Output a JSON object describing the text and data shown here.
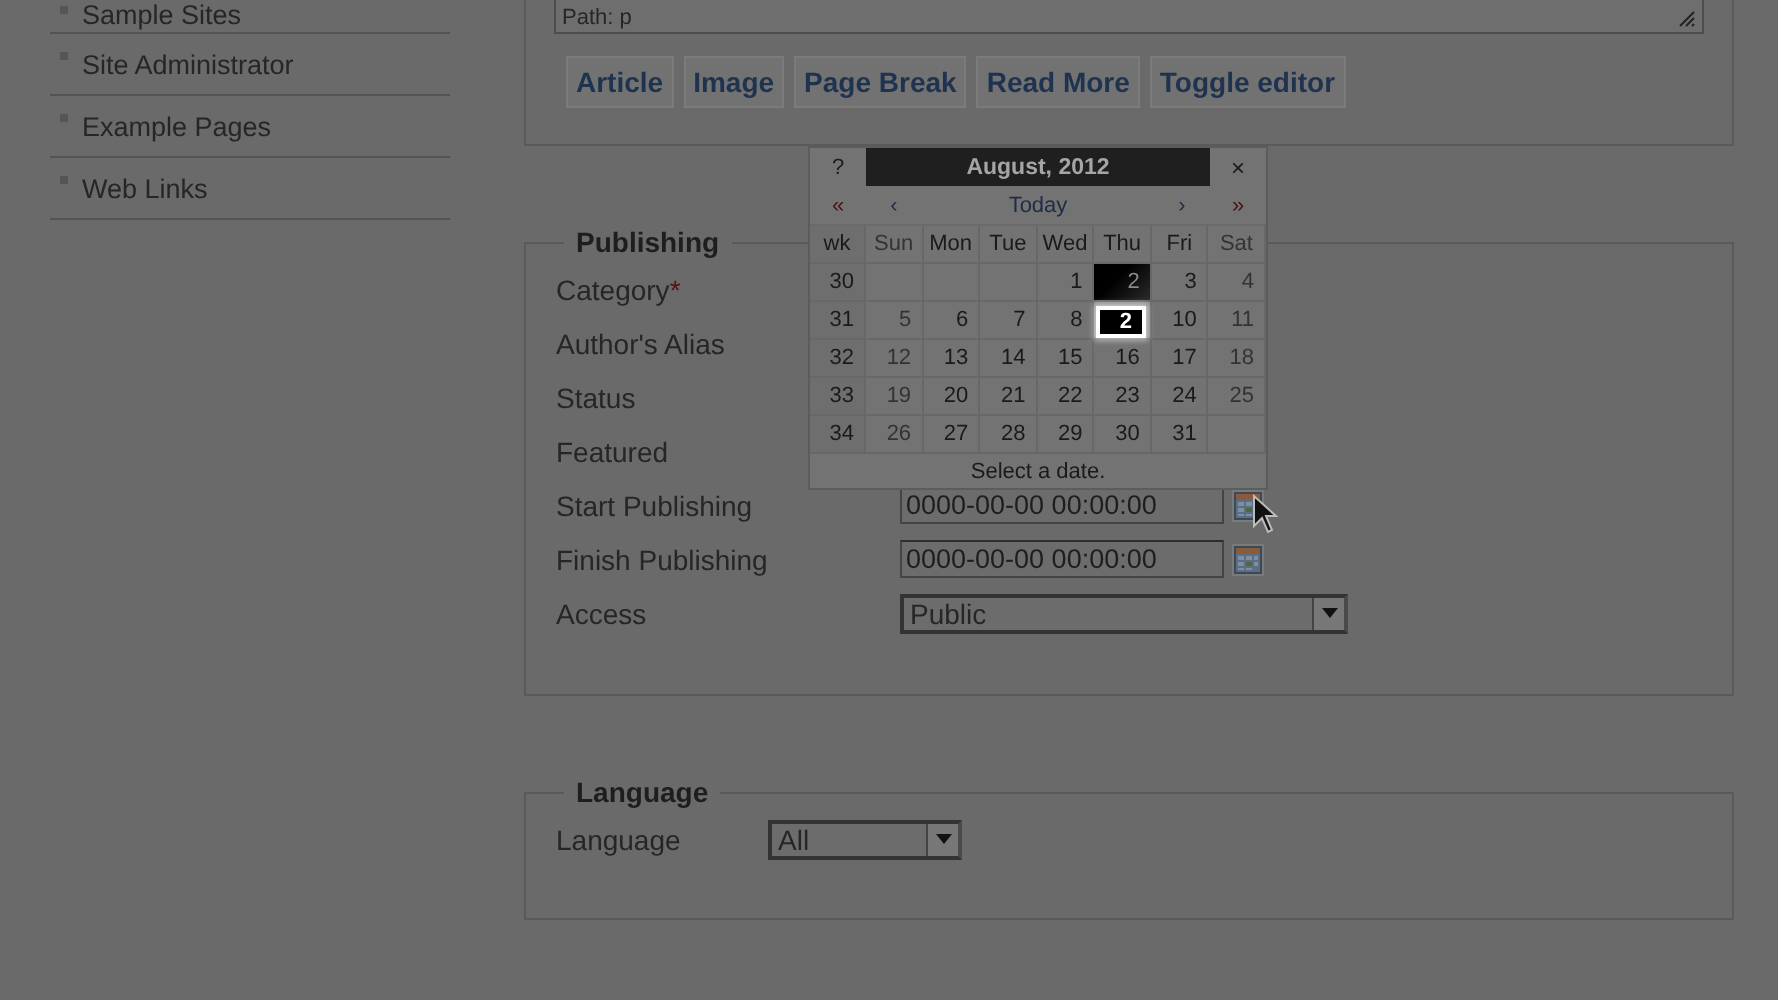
{
  "sidebar": {
    "items": [
      {
        "label": "Sample Sites"
      },
      {
        "label": "Site Administrator"
      },
      {
        "label": "Example Pages"
      },
      {
        "label": "Web Links"
      }
    ]
  },
  "editor": {
    "path": "Path: p",
    "buttons": [
      "Article",
      "Image",
      "Page Break",
      "Read More",
      "Toggle editor"
    ]
  },
  "publishing": {
    "legend": "Publishing",
    "fields": [
      {
        "label": "Category",
        "required_mark": "*",
        "kind": "label"
      },
      {
        "label": "Author's Alias",
        "kind": "label"
      },
      {
        "label": "Status",
        "kind": "label"
      },
      {
        "label": "Featured",
        "kind": "label"
      },
      {
        "label": "Start Publishing",
        "kind": "date",
        "value": "0000-00-00 00:00:00"
      },
      {
        "label": "Finish Publishing",
        "kind": "date",
        "value": "0000-00-00 00:00:00"
      },
      {
        "label": "Access",
        "kind": "select",
        "value": "Public"
      }
    ]
  },
  "calendar": {
    "help": "?",
    "title": "August, 2012",
    "close": "×",
    "nav": [
      "«",
      "‹",
      "Today",
      "›",
      "»"
    ],
    "week_header": "wk",
    "weekdays": [
      {
        "label": "Sun",
        "weekend": true
      },
      {
        "label": "Mon",
        "weekend": false
      },
      {
        "label": "Tue",
        "weekend": false
      },
      {
        "label": "Wed",
        "weekend": false
      },
      {
        "label": "Thu",
        "weekend": false
      },
      {
        "label": "Fri",
        "weekend": false
      },
      {
        "label": "Sat",
        "weekend": true
      }
    ],
    "weeks": [
      {
        "wk": "30",
        "days": [
          {
            "kind": "blank"
          },
          {
            "kind": "blank"
          },
          {
            "kind": "blank"
          },
          {
            "d": "1",
            "selected": false
          },
          {
            "d": "2",
            "selected": true
          },
          {
            "d": "3",
            "selected": false
          },
          {
            "d": "4",
            "selected": false
          }
        ]
      },
      {
        "wk": "31",
        "days": [
          {
            "d": "5",
            "selected": false
          },
          {
            "d": "6",
            "selected": false
          },
          {
            "d": "7",
            "selected": false
          },
          {
            "d": "8",
            "selected": false
          },
          {
            "kind": "covered"
          },
          {
            "d": "10",
            "selected": false
          },
          {
            "d": "11",
            "selected": false
          }
        ]
      },
      {
        "wk": "32",
        "days": [
          {
            "d": "12",
            "selected": false
          },
          {
            "d": "13",
            "selected": false
          },
          {
            "d": "14",
            "selected": false
          },
          {
            "d": "15",
            "selected": false
          },
          {
            "d": "16",
            "selected": false
          },
          {
            "d": "17",
            "selected": false
          },
          {
            "d": "18",
            "selected": false
          }
        ]
      },
      {
        "wk": "33",
        "days": [
          {
            "d": "19",
            "selected": false
          },
          {
            "d": "20",
            "selected": false
          },
          {
            "d": "21",
            "selected": false
          },
          {
            "d": "22",
            "selected": false
          },
          {
            "d": "23",
            "selected": false
          },
          {
            "d": "24",
            "selected": false
          },
          {
            "d": "25",
            "selected": false
          }
        ]
      },
      {
        "wk": "34",
        "days": [
          {
            "d": "26",
            "selected": false
          },
          {
            "d": "27",
            "selected": false
          },
          {
            "d": "28",
            "selected": false
          },
          {
            "d": "29",
            "selected": false
          },
          {
            "d": "30",
            "selected": false
          },
          {
            "d": "31",
            "selected": false
          },
          {
            "kind": "blank"
          }
        ]
      }
    ],
    "footer": "Select a date.",
    "callout": "2"
  },
  "language": {
    "legend": "Language",
    "label": "Language",
    "value": "All"
  }
}
